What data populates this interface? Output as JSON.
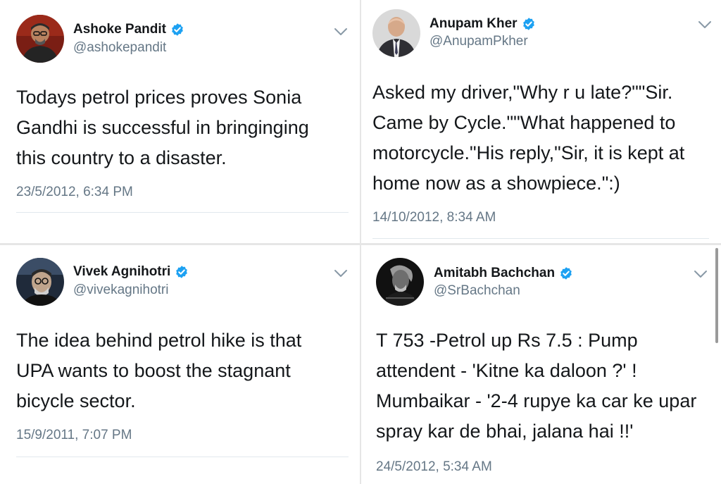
{
  "tweets": [
    {
      "name": "Ashoke Pandit",
      "handle": "@ashokepandit",
      "text": "Todays petrol prices proves Sonia\nGandhi is successful in bringinging\nthis country to a disaster.",
      "timestamp": "23/5/2012, 6:34 PM",
      "verified": true,
      "avatar_icon": "avatar-ashoke-pandit"
    },
    {
      "name": "Anupam Kher",
      "handle": "@AnupamPkher",
      "text": "Asked my driver,\"Why r u late?\"\"Sir.\nCame by Cycle.\"\"What happened to\nmotorcycle.\"His reply,\"Sir, it is kept at\nhome now as a showpiece.\":)",
      "timestamp": "14/10/2012, 8:34 AM",
      "verified": true,
      "avatar_icon": "avatar-anupam-kher"
    },
    {
      "name": "Vivek Agnihotri",
      "handle": "@vivekagnihotri",
      "text": "The idea behind petrol hike is that\nUPA wants to boost the stagnant\nbicycle sector.",
      "timestamp": "15/9/2011, 7:07 PM",
      "verified": true,
      "avatar_icon": "avatar-vivek-agnihotri"
    },
    {
      "name": "Amitabh Bachchan",
      "handle": "@SrBachchan",
      "text": "T 753 -Petrol up Rs 7.5 : Pump\nattendent - 'Kitne ka daloon ?' !\nMumbaikar - '2-4 rupye ka car ke upar\nspray kar de bhai, jalana  hai !!'",
      "timestamp": "24/5/2012, 5:34 AM",
      "verified": true,
      "avatar_icon": "avatar-amitabh-bachchan"
    }
  ],
  "colors": {
    "text": "#14171a",
    "secondary": "#657786",
    "verified_blue": "#1da1f2",
    "divider": "#e6e6e6",
    "chevron": "#8899a6"
  },
  "icons": {
    "verified": "verified-badge-icon",
    "menu": "chevron-down-icon"
  }
}
